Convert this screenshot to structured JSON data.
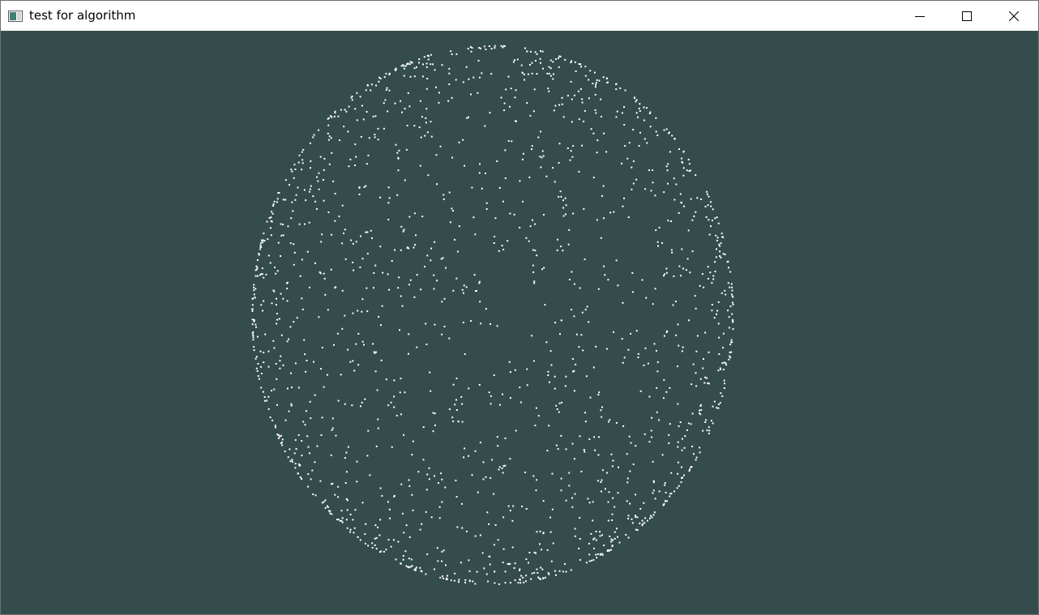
{
  "window": {
    "title": "test for algorithm",
    "app_icon": "app-window-icon",
    "buttons": [
      {
        "name": "minimize-button",
        "icon": "minimize-icon"
      },
      {
        "name": "maximize-button",
        "icon": "maximize-icon"
      },
      {
        "name": "close-button",
        "icon": "close-icon"
      }
    ]
  },
  "scene": {
    "background_color": "#344c4c",
    "point_color": "#ffffff",
    "description_shape": "sphere-point-cloud",
    "point_count": 2600
  }
}
